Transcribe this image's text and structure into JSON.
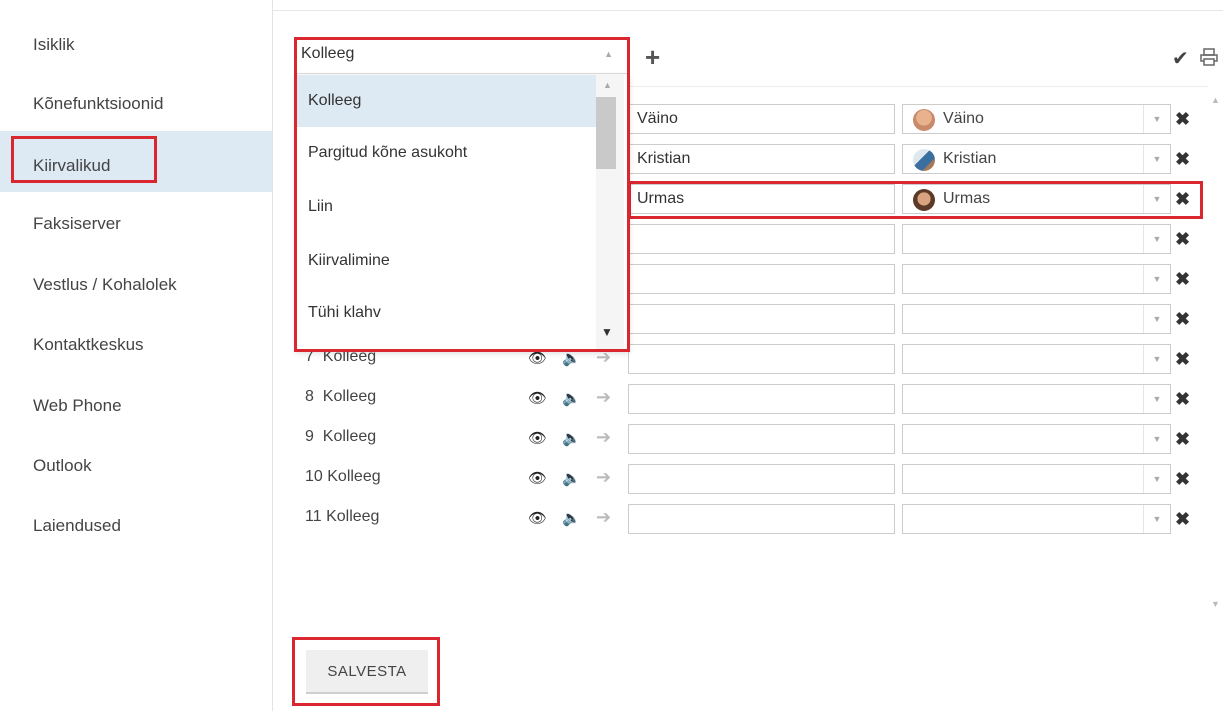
{
  "sidebar": {
    "items": [
      {
        "label": "Isiklik"
      },
      {
        "label": "Kõnefunktsioonid"
      },
      {
        "label": "Kiirvalikud"
      },
      {
        "label": "Faksiserver"
      },
      {
        "label": "Vestlus / Kohalolek"
      },
      {
        "label": "Kontaktkeskus"
      },
      {
        "label": "Web Phone"
      },
      {
        "label": "Outlook"
      },
      {
        "label": "Laiendused"
      }
    ],
    "active": "Kiirvalikud"
  },
  "type_select": {
    "value": "Kolleeg",
    "options": [
      {
        "label": "Kolleeg"
      },
      {
        "label": "Pargitud kõne asukoht"
      },
      {
        "label": "Liin"
      },
      {
        "label": "Kiirvalimine"
      },
      {
        "label": "Tühi klahv"
      }
    ]
  },
  "toolbar": {
    "add_icon": "plus-icon",
    "confirm_icon": "check-icon",
    "print_icon": "printer-icon"
  },
  "rows": [
    {
      "name": "Väino",
      "user": "Väino"
    },
    {
      "name": "Kristian",
      "user": "Kristian"
    },
    {
      "name": "Urmas",
      "user": "Urmas"
    },
    {
      "name": "",
      "user": ""
    },
    {
      "name": "",
      "user": ""
    },
    {
      "name": "",
      "user": ""
    },
    {
      "num": "7",
      "type": "Kolleeg",
      "name": "",
      "user": ""
    },
    {
      "num": "8",
      "type": "Kolleeg",
      "name": "",
      "user": ""
    },
    {
      "num": "9",
      "type": "Kolleeg",
      "name": "",
      "user": ""
    },
    {
      "num": "10",
      "type": "Kolleeg",
      "name": "",
      "user": ""
    },
    {
      "num": "11",
      "type": "Kolleeg",
      "name": "",
      "user": ""
    }
  ],
  "save_label": "SALVESTA",
  "colors": {
    "highlight": "#d9262f",
    "active_bg": "#dde9f3"
  }
}
